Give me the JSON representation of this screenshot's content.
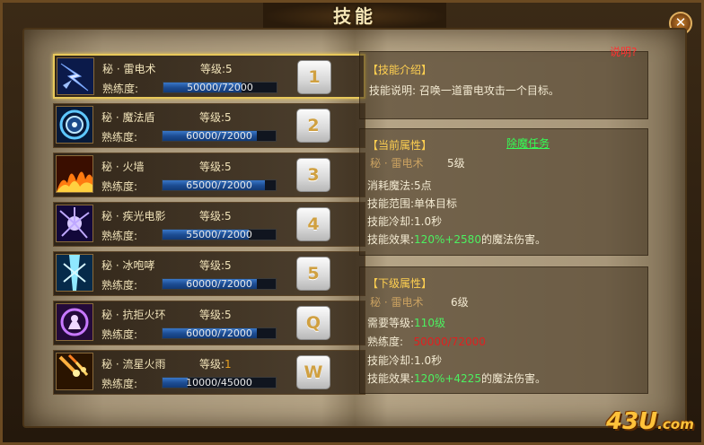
{
  "window": {
    "title": "技能",
    "close_label": "✕"
  },
  "skills": [
    {
      "name": "秘 · 雷电术",
      "level": "等级:5",
      "prof_label": "熟练度:",
      "prof_text": "50000/72000",
      "prof_fraction": 0.694,
      "hotkey": "1",
      "icon": "lightning-icon"
    },
    {
      "name": "秘 · 魔法盾",
      "level": "等级:5",
      "prof_label": "熟练度:",
      "prof_text": "60000/72000",
      "prof_fraction": 0.833,
      "hotkey": "2",
      "icon": "magic-shield-icon"
    },
    {
      "name": "秘 · 火墙",
      "level": "等级:5",
      "prof_label": "熟练度:",
      "prof_text": "65000/72000",
      "prof_fraction": 0.903,
      "hotkey": "3",
      "icon": "fire-wall-icon"
    },
    {
      "name": "秘 · 疾光电影",
      "level": "等级:5",
      "prof_label": "熟练度:",
      "prof_text": "55000/72000",
      "prof_fraction": 0.764,
      "hotkey": "4",
      "icon": "thunder-burst-icon"
    },
    {
      "name": "秘 · 冰咆哮",
      "level": "等级:5",
      "prof_label": "熟练度:",
      "prof_text": "60000/72000",
      "prof_fraction": 0.833,
      "hotkey": "5",
      "icon": "ice-roar-icon"
    },
    {
      "name": "秘 · 抗拒火环",
      "level": "等级:5",
      "prof_label": "熟练度:",
      "prof_text": "60000/72000",
      "prof_fraction": 0.833,
      "hotkey": "Q",
      "icon": "repel-ring-icon"
    },
    {
      "name": "秘 · 流星火雨",
      "level": "等级:",
      "level_num": "1",
      "prof_label": "熟练度:",
      "prof_text": "10000/45000",
      "prof_fraction": 0.222,
      "hotkey": "W",
      "icon": "meteor-rain-icon"
    }
  ],
  "help_link": "说明?",
  "intro": {
    "header": "【技能介绍】",
    "desc": "技能说明: 召唤一道雷电攻击一个目标。"
  },
  "current": {
    "header": "【当前属性】",
    "quest_link": "除魔任务",
    "name": "秘 · 雷电术",
    "level": "5级",
    "mana_cost": "消耗魔法:5点",
    "range": "技能范围:单体目标",
    "cooldown": "技能冷却:1.0秒",
    "effect_label": "技能效果:",
    "effect_value": "120%+2580",
    "effect_suffix": "的魔法伤害。"
  },
  "next": {
    "header": "【下级属性】",
    "name": "秘 · 雷电术",
    "level": "6级",
    "req_label": "需要等级:",
    "req_value": "110级",
    "prof_label": "熟练度:",
    "prof_value": "50000/72000",
    "cooldown": "技能冷却:1.0秒",
    "effect_label": "技能效果:",
    "effect_value": "120%+4225",
    "effect_suffix": "的魔法伤害。"
  },
  "watermark": {
    "main": "43U",
    "suffix": ".com"
  },
  "colors": {
    "highlight": "#e8c85a",
    "header": "#ffd050",
    "bonus": "#4cf060",
    "warning": "#e02020",
    "bar": "#1d4d94"
  }
}
